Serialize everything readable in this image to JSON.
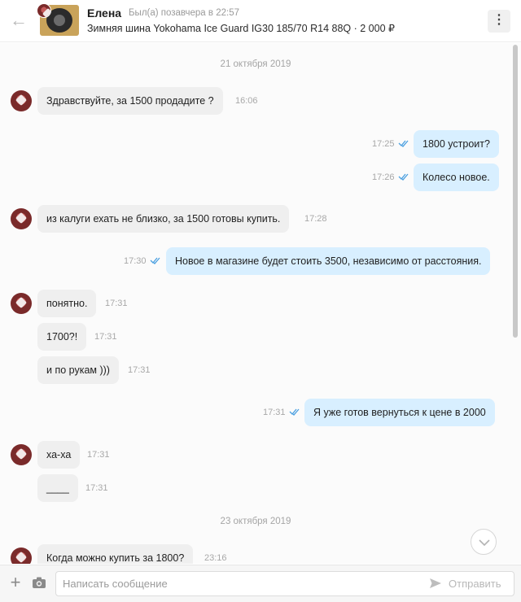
{
  "header": {
    "back_icon": "arrow-left-icon",
    "name": "Елена",
    "status": "Был(а) позавчера в 22:57",
    "subtitle": "Зимняя шина Yokohama Ice Guard IG30 185/70 R14 88Q · 2 000 ₽",
    "menu_icon": "more-vertical-icon"
  },
  "dates": [
    "21 октября 2019",
    "23 октября 2019"
  ],
  "messages": [
    {
      "dir": "in",
      "text": "Здравствуйте, за 1500 продадите ?",
      "time": "16:06"
    },
    {
      "dir": "out",
      "text": "1800 устроит?",
      "time": "17:25"
    },
    {
      "dir": "out",
      "text": "Колесо новое.",
      "time": "17:26"
    },
    {
      "dir": "in",
      "text": "из калуги ехать не близко, за 1500 готовы купить.",
      "time": "17:28"
    },
    {
      "dir": "out",
      "text": "Новое в магазине будет стоить 3500, независимо от расстояния.",
      "time": "17:30"
    },
    {
      "dir": "in",
      "text": "понятно.",
      "time": "17:31"
    },
    {
      "dir": "in",
      "text": "1700?!",
      "time": "17:31"
    },
    {
      "dir": "in",
      "text": "и по рукам )))",
      "time": "17:31"
    },
    {
      "dir": "out",
      "text": "Я уже готов вернуться к цене в 2000",
      "time": "17:31"
    },
    {
      "dir": "in",
      "text": "ха-ха",
      "time": "17:31"
    },
    {
      "dir": "in",
      "text": "____",
      "time": "17:31"
    },
    {
      "dir": "in",
      "text": "Когда можно купить за 1800?",
      "time": "23:16"
    }
  ],
  "compose": {
    "placeholder": "Написать сообщение",
    "send_label": "Отправить",
    "attach_icon": "plus-icon",
    "camera_icon": "camera-icon",
    "send_icon": "send-icon"
  },
  "colors": {
    "incoming_bubble": "#efefef",
    "outgoing_bubble": "#d8efff",
    "read_check": "#4a9fe0"
  }
}
